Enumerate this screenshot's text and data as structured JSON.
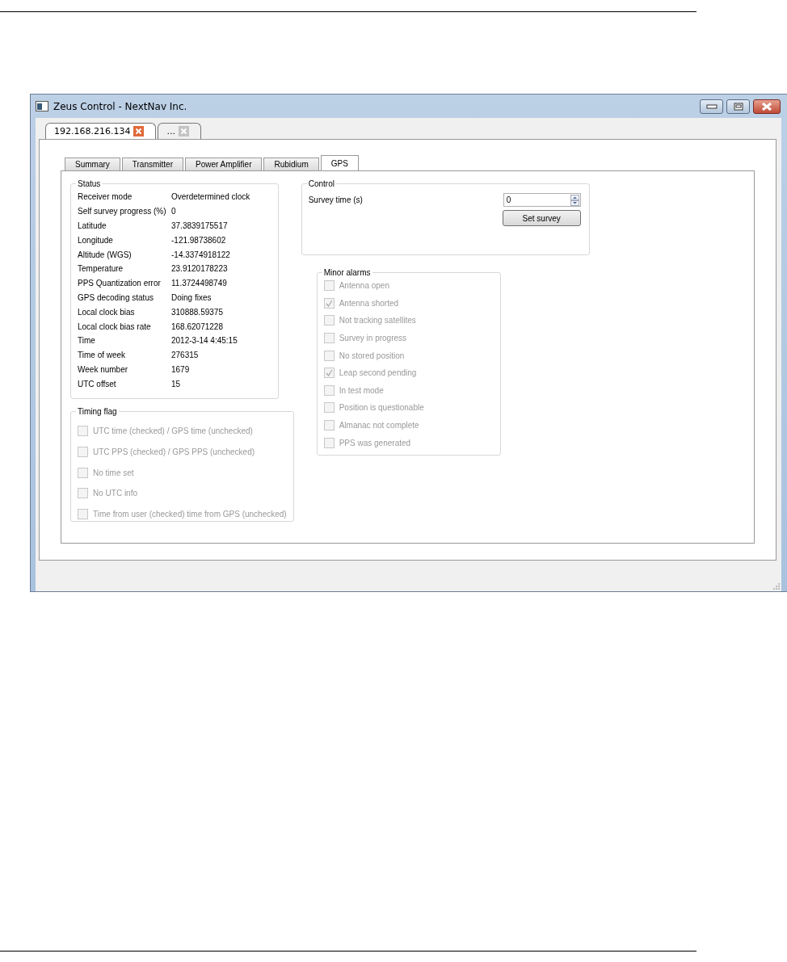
{
  "window": {
    "title": "Zeus Control - NextNav Inc."
  },
  "connection_tabs": [
    {
      "label": "192.168.216.134",
      "selected": true
    },
    {
      "label": "...",
      "selected": false
    }
  ],
  "tabs": [
    {
      "label": "Summary",
      "selected": false
    },
    {
      "label": "Transmitter",
      "selected": false
    },
    {
      "label": "Power Amplifier",
      "selected": false
    },
    {
      "label": "Rubidium",
      "selected": false
    },
    {
      "label": "GPS",
      "selected": true
    }
  ],
  "status": {
    "title": "Status",
    "rows": [
      {
        "label": "Receiver mode",
        "value": "Overdetermined clock"
      },
      {
        "label": "Self survey progress (%)",
        "value": "0"
      },
      {
        "label": "Latitude",
        "value": "37.3839175517"
      },
      {
        "label": "Longitude",
        "value": "-121.98738602"
      },
      {
        "label": "Altitude (WGS)",
        "value": "-14.3374918122"
      },
      {
        "label": "Temperature",
        "value": "23.9120178223"
      },
      {
        "label": "PPS Quantization error",
        "value": "11.3724498749"
      },
      {
        "label": "GPS decoding status",
        "value": "Doing fixes"
      },
      {
        "label": "Local clock bias",
        "value": "310888.59375"
      },
      {
        "label": "Local clock bias rate",
        "value": "168.62071228"
      },
      {
        "label": "Time",
        "value": "2012-3-14 4:45:15"
      },
      {
        "label": "Time of week",
        "value": "276315"
      },
      {
        "label": "Week number",
        "value": "1679"
      },
      {
        "label": "UTC offset",
        "value": "15"
      }
    ]
  },
  "timing_flag": {
    "title": "Timing flag",
    "items": [
      {
        "label": "UTC time (checked) / GPS time (unchecked)",
        "checked": false,
        "disabled": true
      },
      {
        "label": "UTC PPS (checked) / GPS PPS (unchecked)",
        "checked": false,
        "disabled": true
      },
      {
        "label": "No time set",
        "checked": false,
        "disabled": true
      },
      {
        "label": "No UTC info",
        "checked": false,
        "disabled": true
      },
      {
        "label": "Time from user (checked) time from GPS (unchecked)",
        "checked": false,
        "disabled": true
      }
    ]
  },
  "control": {
    "title": "Control",
    "survey_label": "Survey time (s)",
    "survey_value": "0",
    "button": "Set survey"
  },
  "minor_alarms": {
    "title": "Minor alarms",
    "items": [
      {
        "label": "Antenna open",
        "checked": false,
        "disabled": true
      },
      {
        "label": "Antenna shorted",
        "checked": true,
        "disabled": true
      },
      {
        "label": "Not tracking satellites",
        "checked": false,
        "disabled": true
      },
      {
        "label": "Survey in progress",
        "checked": false,
        "disabled": true
      },
      {
        "label": "No stored position",
        "checked": false,
        "disabled": true
      },
      {
        "label": "Leap second pending",
        "checked": true,
        "disabled": true
      },
      {
        "label": "In test mode",
        "checked": false,
        "disabled": true
      },
      {
        "label": "Position is questionable",
        "checked": false,
        "disabled": true
      },
      {
        "label": "Almanac not complete",
        "checked": false,
        "disabled": true
      },
      {
        "label": "PPS was generated",
        "checked": false,
        "disabled": true
      }
    ]
  }
}
